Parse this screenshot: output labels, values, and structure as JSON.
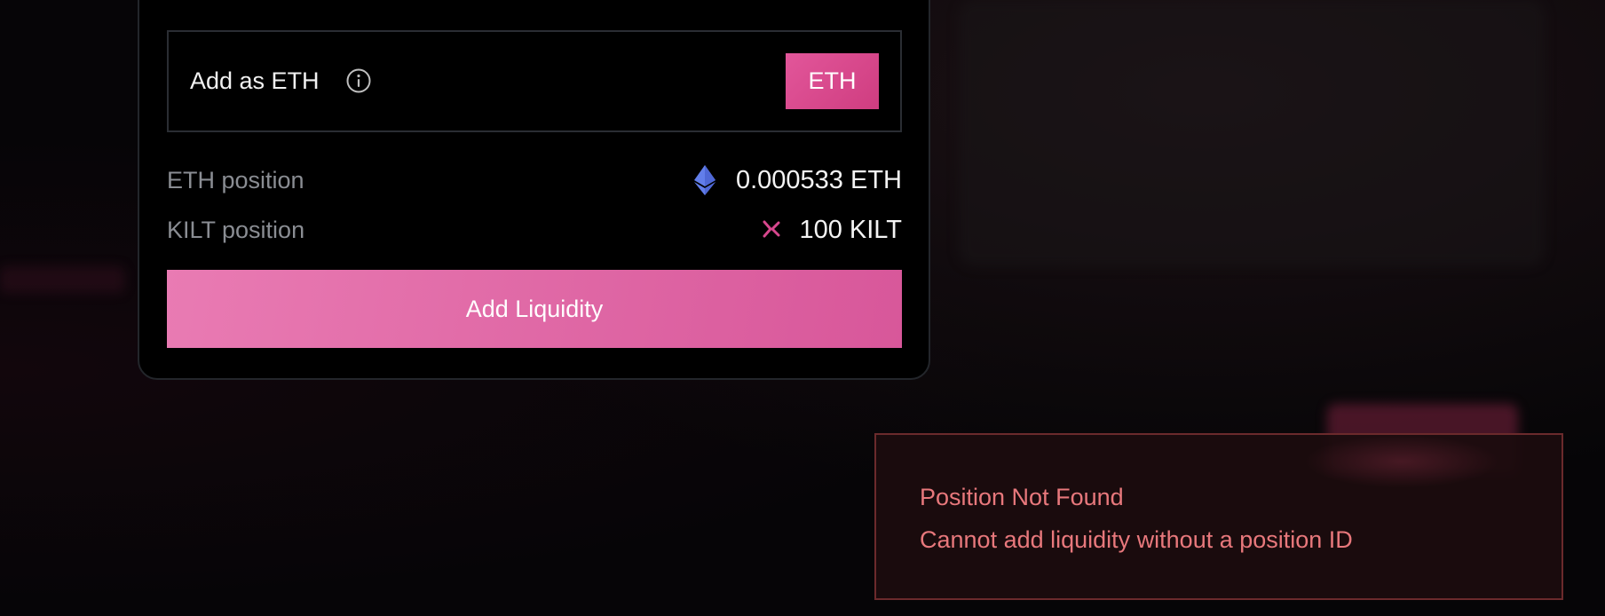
{
  "modal": {
    "mode_label": "Add as ETH",
    "mode_toggle_label": "ETH",
    "rows": [
      {
        "label": "ETH position",
        "value": "0.000533 ETH",
        "icon": "ethereum-icon"
      },
      {
        "label": "KILT position",
        "value": "100 KILT",
        "icon": "kilt-icon"
      }
    ],
    "primary_action": "Add Liquidity"
  },
  "toast": {
    "title": "Position Not Found",
    "description": "Cannot add liquidity without a position ID"
  },
  "colors": {
    "accent_pink": "#e2569a",
    "error_text": "#e8787c",
    "error_border": "#6b2a2c",
    "ethereum": "#627eea"
  }
}
